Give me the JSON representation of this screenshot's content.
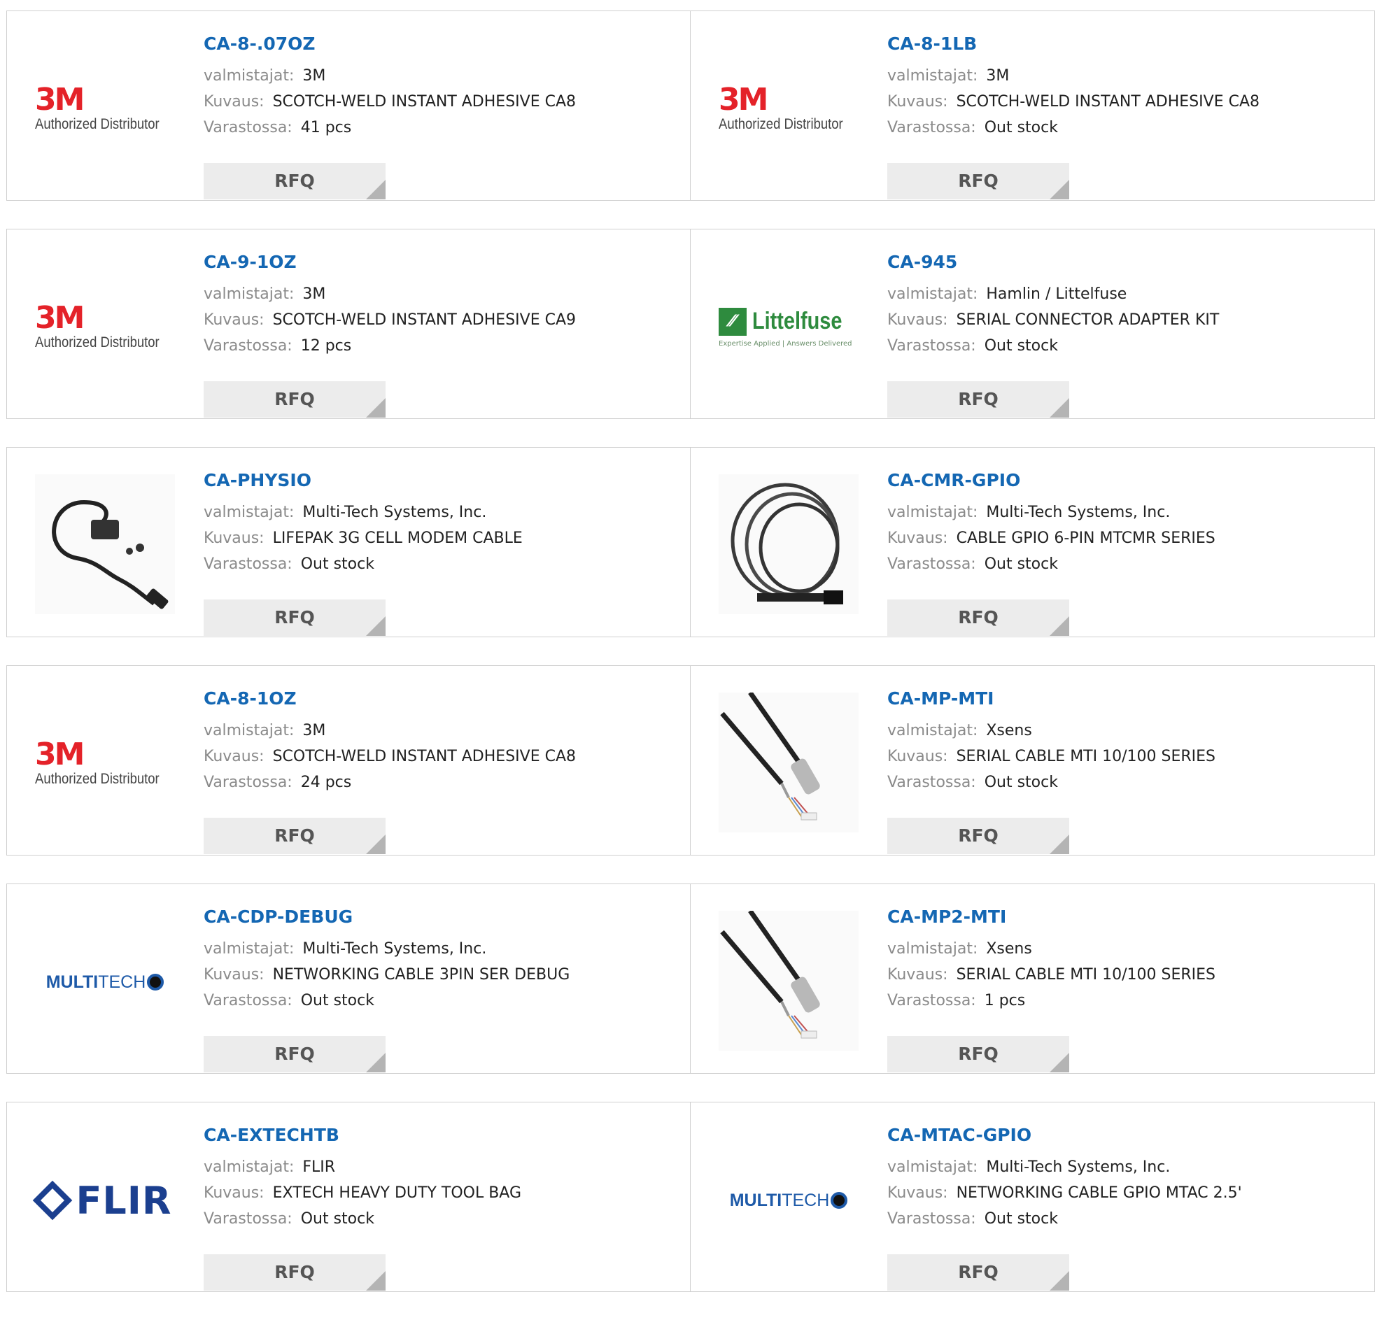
{
  "labels": {
    "manufacturer": "valmistajat:",
    "description": "Kuvaus:",
    "stock": "Varastossa:",
    "rfq": "RFQ"
  },
  "logos": {
    "3m_mark": "3M",
    "3m_sub": "Authorized Distributor",
    "littelfuse_name": "Littelfuse",
    "littelfuse_tag": "Expertise Applied | Answers Delivered",
    "multitech_bold": "MULTI",
    "multitech_rest": "TECH",
    "flir": "FLIR"
  },
  "products": [
    {
      "pn": "CA-8-.07OZ",
      "manufacturer": "3M",
      "description": "SCOTCH-WELD INSTANT ADHESIVE CA8",
      "stock": "41 pcs",
      "image": "3m-logo"
    },
    {
      "pn": "CA-8-1LB",
      "manufacturer": "3M",
      "description": "SCOTCH-WELD INSTANT ADHESIVE CA8",
      "stock": "Out stock",
      "image": "3m-logo"
    },
    {
      "pn": "CA-9-1OZ",
      "manufacturer": "3M",
      "description": "SCOTCH-WELD INSTANT ADHESIVE CA9",
      "stock": "12 pcs",
      "image": "3m-logo"
    },
    {
      "pn": "CA-945",
      "manufacturer": "Hamlin / Littelfuse",
      "description": "SERIAL CONNECTOR ADAPTER KIT",
      "stock": "Out stock",
      "image": "littelfuse-logo"
    },
    {
      "pn": "CA-PHYSIO",
      "manufacturer": "Multi-Tech Systems, Inc.",
      "description": "LIFEPAK 3G CELL MODEM CABLE",
      "stock": "Out stock",
      "image": "modem-cable-photo"
    },
    {
      "pn": "CA-CMR-GPIO",
      "manufacturer": "Multi-Tech Systems, Inc.",
      "description": "CABLE GPIO 6-PIN MTCMR SERIES",
      "stock": "Out stock",
      "image": "coiled-cable-photo"
    },
    {
      "pn": "CA-8-1OZ",
      "manufacturer": "3M",
      "description": "SCOTCH-WELD INSTANT ADHESIVE CA8",
      "stock": "24 pcs",
      "image": "3m-logo"
    },
    {
      "pn": "CA-MP-MTI",
      "manufacturer": "Xsens",
      "description": "SERIAL CABLE MTI 10/100 SERIES",
      "stock": "Out stock",
      "image": "serial-cable-photo"
    },
    {
      "pn": "CA-CDP-DEBUG",
      "manufacturer": "Multi-Tech Systems, Inc.",
      "description": "NETWORKING CABLE 3PIN SER DEBUG",
      "stock": "Out stock",
      "image": "multitech-logo"
    },
    {
      "pn": "CA-MP2-MTI",
      "manufacturer": "Xsens",
      "description": "SERIAL CABLE MTI 10/100 SERIES",
      "stock": "1 pcs",
      "image": "serial-cable-photo"
    },
    {
      "pn": "CA-EXTECHTB",
      "manufacturer": "FLIR",
      "description": "EXTECH HEAVY DUTY TOOL BAG",
      "stock": "Out stock",
      "image": "flir-logo"
    },
    {
      "pn": "CA-MTAC-GPIO",
      "manufacturer": "Multi-Tech Systems, Inc.",
      "description": "NETWORKING CABLE GPIO MTAC 2.5'",
      "stock": "Out stock",
      "image": "multitech-logo"
    }
  ]
}
